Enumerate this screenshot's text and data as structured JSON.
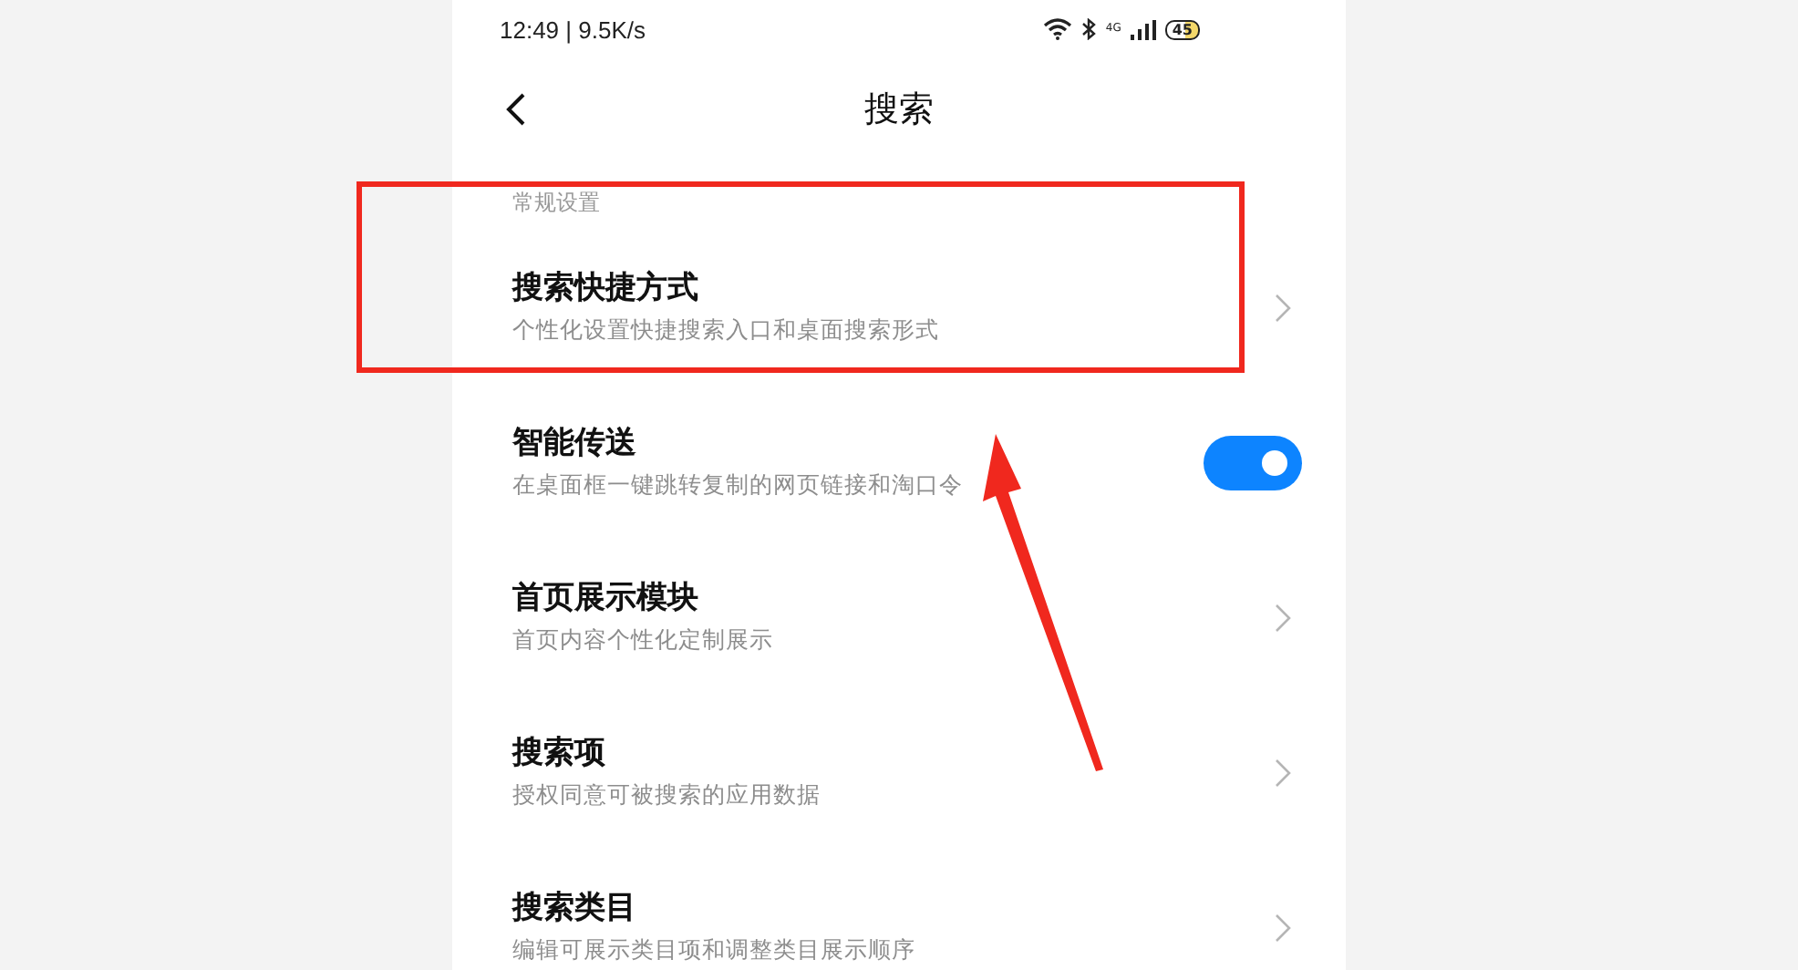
{
  "status_bar": {
    "time": "12:49 | 9.5K/s",
    "network": "4G",
    "battery": "45"
  },
  "header": {
    "title": "搜索"
  },
  "section": {
    "label": "常规设置"
  },
  "items": [
    {
      "kind": "link",
      "title": "搜索快捷方式",
      "subtitle": "个性化设置快捷搜索入口和桌面搜索形式"
    },
    {
      "kind": "toggle",
      "title": "智能传送",
      "subtitle": "在桌面框一键跳转复制的网页链接和淘口令",
      "on": true
    },
    {
      "kind": "link",
      "title": "首页展示模块",
      "subtitle": "首页内容个性化定制展示"
    },
    {
      "kind": "link",
      "title": "搜索项",
      "subtitle": "授权同意可被搜索的应用数据"
    },
    {
      "kind": "link",
      "title": "搜索类目",
      "subtitle": "编辑可展示类目项和调整类目展示顺序"
    }
  ]
}
